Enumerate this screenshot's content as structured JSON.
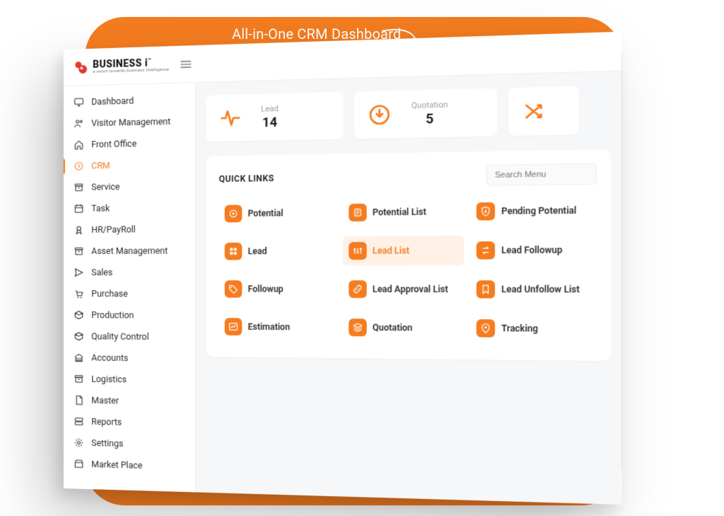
{
  "heading": "All-in-One CRM Dashboard",
  "brand": {
    "name": "BUSINESS i",
    "tagline": "a vision towards business intelligence",
    "tm": "™"
  },
  "sidebar": {
    "items": [
      {
        "label": "Dashboard",
        "icon": "monitor-icon"
      },
      {
        "label": "Visitor Management",
        "icon": "users-icon"
      },
      {
        "label": "Front Office",
        "icon": "home-icon"
      },
      {
        "label": "CRM",
        "icon": "clock-icon",
        "active": true
      },
      {
        "label": "Service",
        "icon": "archive-icon"
      },
      {
        "label": "Task",
        "icon": "calendar-icon"
      },
      {
        "label": "HR/PayRoll",
        "icon": "award-icon"
      },
      {
        "label": "Asset Management",
        "icon": "archive-icon"
      },
      {
        "label": "Sales",
        "icon": "send-icon"
      },
      {
        "label": "Purchase",
        "icon": "cart-icon"
      },
      {
        "label": "Production",
        "icon": "box-icon"
      },
      {
        "label": "Quality Control",
        "icon": "box-icon"
      },
      {
        "label": "Accounts",
        "icon": "bank-icon"
      },
      {
        "label": "Logistics",
        "icon": "archive-icon"
      },
      {
        "label": "Master",
        "icon": "file-icon"
      },
      {
        "label": "Reports",
        "icon": "server-icon"
      },
      {
        "label": "Settings",
        "icon": "gear-icon"
      },
      {
        "label": "Market Place",
        "icon": "storefront-icon"
      }
    ]
  },
  "stats": [
    {
      "label": "Lead",
      "value": "14",
      "icon": "pulse-icon"
    },
    {
      "label": "Quotation",
      "value": "5",
      "icon": "download-circle-icon"
    },
    {
      "label": "",
      "value": "",
      "icon": "shuffle-icon"
    }
  ],
  "quicklinks": {
    "title": "QUICK LINKS",
    "search_placeholder": "Search Menu",
    "items": [
      {
        "label": "Potential",
        "icon": "play-icon"
      },
      {
        "label": "Potential List",
        "icon": "list-icon"
      },
      {
        "label": "Pending Potential",
        "icon": "shield-down-icon"
      },
      {
        "label": "Lead",
        "icon": "grid-icon"
      },
      {
        "label": "Lead List",
        "icon": "sliders-icon",
        "active": true
      },
      {
        "label": "Lead Followup",
        "icon": "swap-icon"
      },
      {
        "label": "Followup",
        "icon": "tag-icon"
      },
      {
        "label": "Lead Approval List",
        "icon": "link-icon"
      },
      {
        "label": "Lead Unfollow List",
        "icon": "bookmark-icon"
      },
      {
        "label": "Estimation",
        "icon": "chart-icon"
      },
      {
        "label": "Quotation",
        "icon": "layers-icon"
      },
      {
        "label": "Tracking",
        "icon": "pin-icon"
      }
    ]
  },
  "colors": {
    "accent": "#f57c1f"
  }
}
